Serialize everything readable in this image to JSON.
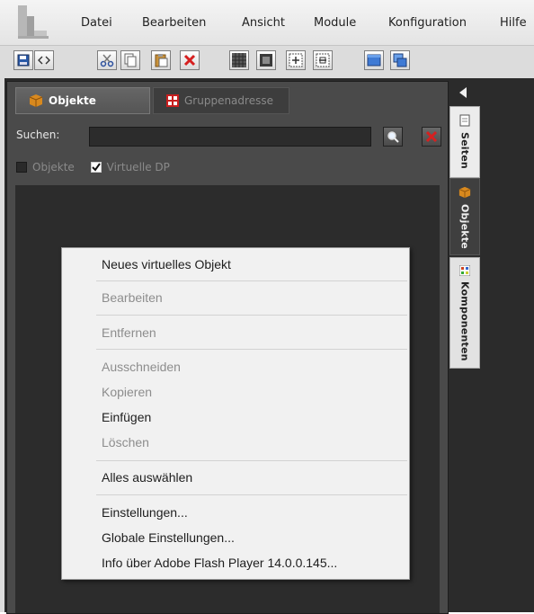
{
  "menubar": {
    "items": [
      "Datei",
      "Bearbeiten",
      "Ansicht",
      "Module",
      "Konfiguration",
      "Hilfe"
    ]
  },
  "toolbar": {
    "buttons": [
      "save-icon",
      "code-icon",
      "cut-icon",
      "copy-icon",
      "paste-icon",
      "delete-icon",
      "grid-icon",
      "frame-icon",
      "zoom-in-icon",
      "zoom-out-icon",
      "window-icon",
      "window-stack-icon"
    ]
  },
  "panel": {
    "tabs": {
      "objekte": "Objekte",
      "gruppenadresse": "Gruppenadresse"
    },
    "search": {
      "label": "Suchen:",
      "value": ""
    },
    "filters": {
      "objekte": "Objekte",
      "objekte_checked": false,
      "virtuelle_dp": "Virtuelle DP",
      "virtuelle_dp_checked": true
    }
  },
  "side_tabs": {
    "seiten": "Seiten",
    "objekte": "Objekte",
    "komponenten": "Komponenten"
  },
  "context_menu": {
    "new_virtual_object": "Neues virtuelles Objekt",
    "edit": "Bearbeiten",
    "remove": "Entfernen",
    "cut": "Ausschneiden",
    "copy": "Kopieren",
    "paste": "Einfügen",
    "delete": "Löschen",
    "select_all": "Alles auswählen",
    "settings": "Einstellungen...",
    "global_settings": "Globale Einstellungen...",
    "about_flash": "Info über Adobe Flash Player 14.0.0.145..."
  },
  "colors": {
    "workspace": "#2b2b2b",
    "panel": "#4a4a4a",
    "menu_bg": "#f1f1f1",
    "delete_red": "#d62020"
  }
}
